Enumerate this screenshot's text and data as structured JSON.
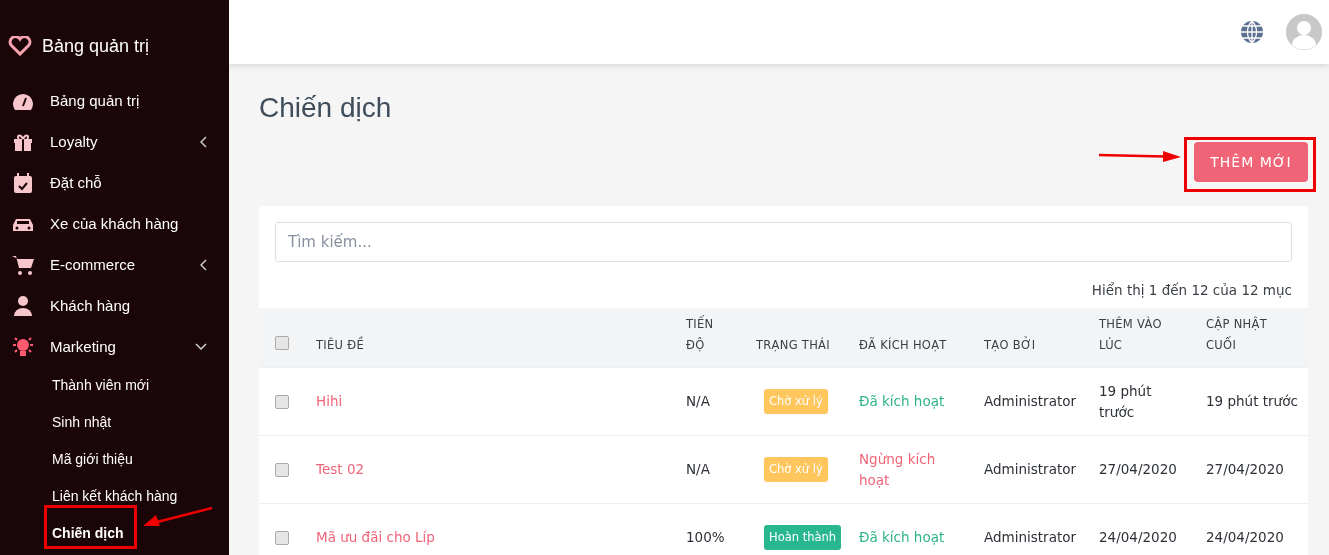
{
  "sidebar": {
    "brand": "Bảng quản trị",
    "items": [
      {
        "label": "Bảng quản trị"
      },
      {
        "label": "Loyalty",
        "expanded": false
      },
      {
        "label": "Đặt chỗ"
      },
      {
        "label": "Xe của khách hàng"
      },
      {
        "label": "E-commerce",
        "expanded": false
      },
      {
        "label": "Khách hàng"
      },
      {
        "label": "Marketing",
        "expanded": true,
        "children": [
          {
            "label": "Thành viên mới",
            "selected": false
          },
          {
            "label": "Sinh nhật",
            "selected": false
          },
          {
            "label": "Mã giới thiệu",
            "selected": false
          },
          {
            "label": "Liên kết khách hàng",
            "selected": false
          },
          {
            "label": "Chiến dịch",
            "selected": true
          }
        ]
      }
    ]
  },
  "page": {
    "title": "Chiến dịch",
    "add_button": "THÊM MỚI"
  },
  "search": {
    "placeholder": "Tìm kiếm..."
  },
  "summary": "Hiển thị 1 đến 12 của 12 mục",
  "table": {
    "select_all": {
      "checked": false
    },
    "columns": [
      "TIÊU ĐỀ",
      "TIẾN ĐỘ",
      "TRẠNG THÁI",
      "ĐÃ KÍCH HOẠT",
      "TẠO BỞI",
      "THÊM VÀO LÚC",
      "CẬP NHẬT CUỐI"
    ],
    "rows": [
      {
        "checked": false,
        "title": "Hihi",
        "progress": "N/A",
        "status": "Chờ xử lý",
        "color": "#ffc65d",
        "activated": true,
        "activation": "Đã kích hoạt",
        "created_by": "Administrator",
        "added": "19 phút trước",
        "updated": "19 phút trước"
      },
      {
        "checked": false,
        "title": "Test 02",
        "progress": "N/A",
        "status": "Chờ xử lý",
        "color": "#ffc65d",
        "activated": false,
        "activation": "Ngừng kích hoạt",
        "created_by": "Administrator",
        "added": "27/04/2020",
        "updated": "27/04/2020"
      },
      {
        "checked": false,
        "title": "Mã ưu đãi cho Líp",
        "progress": "100%",
        "status": "Hoàn thành",
        "color": "#28b78f",
        "activated": true,
        "activation": "Đã kích hoạt",
        "created_by": "Administrator",
        "added": "24/04/2020",
        "updated": "24/04/2020"
      }
    ]
  }
}
